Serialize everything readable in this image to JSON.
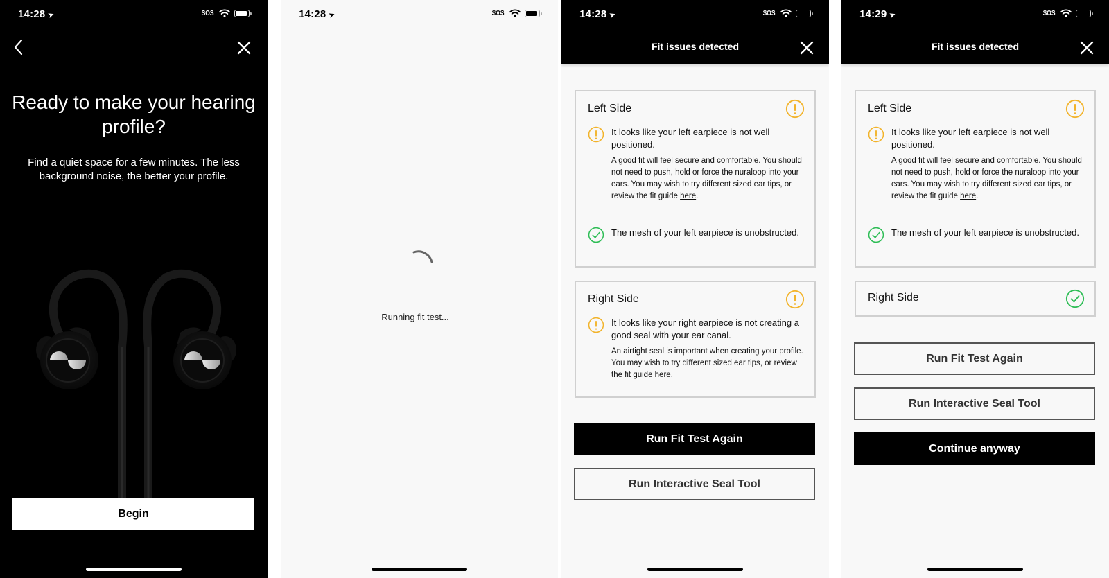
{
  "colors": {
    "warning": "#f2b32a",
    "success": "#2dbd55",
    "dark": "#000000",
    "light_bg": "#f8f8f8"
  },
  "screens": [
    {
      "status": {
        "time": "14:28",
        "sos": "SOS"
      },
      "icons": {
        "back": "chevron-left-icon",
        "close": "close-icon"
      },
      "title": "Ready to make your hearing profile?",
      "subtitle": "Find a quiet space for a few minutes. The less background noise, the better your profile.",
      "begin_label": "Begin"
    },
    {
      "status": {
        "time": "14:28",
        "sos": "SOS"
      },
      "loading_text": "Running fit test..."
    },
    {
      "status": {
        "time": "14:28",
        "sos": "SOS"
      },
      "header_title": "Fit issues detected",
      "left_card": {
        "title": "Left Side",
        "status": "warning",
        "issue_1": {
          "text": "It looks like your left earpiece is not well positioned.",
          "detail": "A good fit will feel secure and comfortable. You should not need to push, hold or force the nuraloop into your ears. You may wish to try different sized ear tips, or review the fit guide ",
          "link": "here",
          "after": "."
        },
        "issue_2": {
          "text": "The mesh of your left earpiece is unobstructed.",
          "status": "ok"
        }
      },
      "right_card": {
        "title": "Right Side",
        "status": "warning",
        "issue_1": {
          "text": "It looks like your right earpiece is not creating a good seal with your ear canal.",
          "detail": "An airtight seal is important when creating your profile. You may wish to try different sized ear tips, or review the fit guide ",
          "link": "here",
          "after": "."
        }
      },
      "buttons": {
        "run_again": "Run Fit Test Again",
        "seal_tool": "Run Interactive Seal Tool"
      }
    },
    {
      "status": {
        "time": "14:29",
        "sos": "SOS"
      },
      "header_title": "Fit issues detected",
      "left_card": {
        "title": "Left Side",
        "status": "warning",
        "issue_1": {
          "text": "It looks like your left earpiece is not well positioned.",
          "detail": "A good fit will feel secure and comfortable. You should not need to push, hold or force the nuraloop into your ears. You may wish to try different sized ear tips, or review the fit guide ",
          "link": "here",
          "after": "."
        },
        "issue_2": {
          "text": "The mesh of your left earpiece is unobstructed.",
          "status": "ok"
        }
      },
      "right_card": {
        "title": "Right Side",
        "status": "ok"
      },
      "buttons": {
        "run_again": "Run Fit Test Again",
        "seal_tool": "Run Interactive Seal Tool",
        "continue": "Continue anyway"
      }
    }
  ]
}
